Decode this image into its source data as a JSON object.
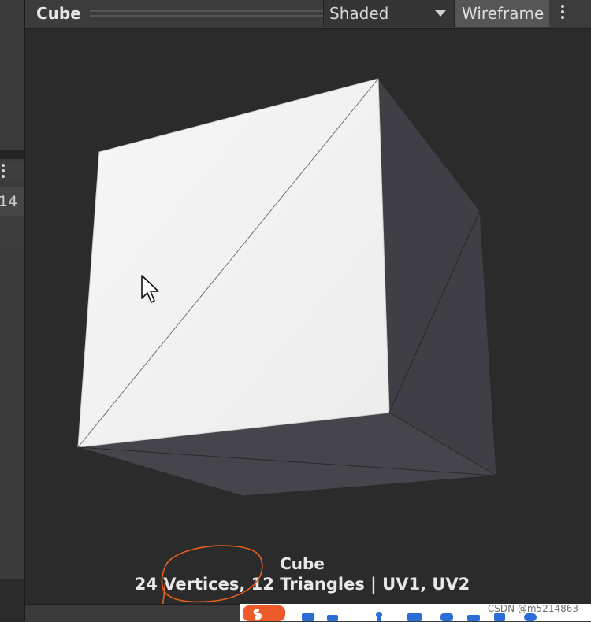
{
  "left_panel": {
    "partial_number": "14"
  },
  "toolbar": {
    "title": "Cube",
    "shading_mode": "Shaded",
    "wireframe_label": "Wireframe"
  },
  "viewport": {
    "mesh_name": "Cube",
    "mesh_stats": "24 Vertices, 12 Triangles | UV1, UV2"
  },
  "watermark": "CSDN @m5214863",
  "colors": {
    "face_lit": "#f3f3f3",
    "face_dark": "#404046",
    "annotation": "#e8601c",
    "viewport_bg": "#2b2b2b"
  }
}
